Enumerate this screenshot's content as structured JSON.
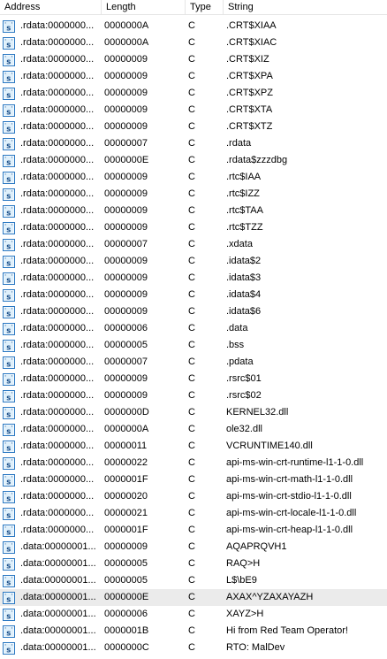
{
  "columns": {
    "address": "Address",
    "length": "Length",
    "type": "Type",
    "string": "String"
  },
  "icon": "string-literal-icon",
  "selected_row": 34,
  "rows": [
    {
      "address": ".rdata:0000000...",
      "length": "0000000A",
      "type": "C",
      "string": ".CRT$XIAA"
    },
    {
      "address": ".rdata:0000000...",
      "length": "0000000A",
      "type": "C",
      "string": ".CRT$XIAC"
    },
    {
      "address": ".rdata:0000000...",
      "length": "00000009",
      "type": "C",
      "string": ".CRT$XIZ"
    },
    {
      "address": ".rdata:0000000...",
      "length": "00000009",
      "type": "C",
      "string": ".CRT$XPA"
    },
    {
      "address": ".rdata:0000000...",
      "length": "00000009",
      "type": "C",
      "string": ".CRT$XPZ"
    },
    {
      "address": ".rdata:0000000...",
      "length": "00000009",
      "type": "C",
      "string": ".CRT$XTA"
    },
    {
      "address": ".rdata:0000000...",
      "length": "00000009",
      "type": "C",
      "string": ".CRT$XTZ"
    },
    {
      "address": ".rdata:0000000...",
      "length": "00000007",
      "type": "C",
      "string": ".rdata"
    },
    {
      "address": ".rdata:0000000...",
      "length": "0000000E",
      "type": "C",
      "string": ".rdata$zzzdbg"
    },
    {
      "address": ".rdata:0000000...",
      "length": "00000009",
      "type": "C",
      "string": ".rtc$IAA"
    },
    {
      "address": ".rdata:0000000...",
      "length": "00000009",
      "type": "C",
      "string": ".rtc$IZZ"
    },
    {
      "address": ".rdata:0000000...",
      "length": "00000009",
      "type": "C",
      "string": ".rtc$TAA"
    },
    {
      "address": ".rdata:0000000...",
      "length": "00000009",
      "type": "C",
      "string": ".rtc$TZZ"
    },
    {
      "address": ".rdata:0000000...",
      "length": "00000007",
      "type": "C",
      "string": ".xdata"
    },
    {
      "address": ".rdata:0000000...",
      "length": "00000009",
      "type": "C",
      "string": ".idata$2"
    },
    {
      "address": ".rdata:0000000...",
      "length": "00000009",
      "type": "C",
      "string": ".idata$3"
    },
    {
      "address": ".rdata:0000000...",
      "length": "00000009",
      "type": "C",
      "string": ".idata$4"
    },
    {
      "address": ".rdata:0000000...",
      "length": "00000009",
      "type": "C",
      "string": ".idata$6"
    },
    {
      "address": ".rdata:0000000...",
      "length": "00000006",
      "type": "C",
      "string": ".data"
    },
    {
      "address": ".rdata:0000000...",
      "length": "00000005",
      "type": "C",
      "string": ".bss"
    },
    {
      "address": ".rdata:0000000...",
      "length": "00000007",
      "type": "C",
      "string": ".pdata"
    },
    {
      "address": ".rdata:0000000...",
      "length": "00000009",
      "type": "C",
      "string": ".rsrc$01"
    },
    {
      "address": ".rdata:0000000...",
      "length": "00000009",
      "type": "C",
      "string": ".rsrc$02"
    },
    {
      "address": ".rdata:0000000...",
      "length": "0000000D",
      "type": "C",
      "string": "KERNEL32.dll"
    },
    {
      "address": ".rdata:0000000...",
      "length": "0000000A",
      "type": "C",
      "string": "ole32.dll"
    },
    {
      "address": ".rdata:0000000...",
      "length": "00000011",
      "type": "C",
      "string": "VCRUNTIME140.dll"
    },
    {
      "address": ".rdata:0000000...",
      "length": "00000022",
      "type": "C",
      "string": "api-ms-win-crt-runtime-l1-1-0.dll"
    },
    {
      "address": ".rdata:0000000...",
      "length": "0000001F",
      "type": "C",
      "string": "api-ms-win-crt-math-l1-1-0.dll"
    },
    {
      "address": ".rdata:0000000...",
      "length": "00000020",
      "type": "C",
      "string": "api-ms-win-crt-stdio-l1-1-0.dll"
    },
    {
      "address": ".rdata:0000000...",
      "length": "00000021",
      "type": "C",
      "string": "api-ms-win-crt-locale-l1-1-0.dll"
    },
    {
      "address": ".rdata:0000000...",
      "length": "0000001F",
      "type": "C",
      "string": "api-ms-win-crt-heap-l1-1-0.dll"
    },
    {
      "address": ".data:00000001...",
      "length": "00000009",
      "type": "C",
      "string": "AQAPRQVH1"
    },
    {
      "address": ".data:00000001...",
      "length": "00000005",
      "type": "C",
      "string": "RAQ>H"
    },
    {
      "address": ".data:00000001...",
      "length": "00000005",
      "type": "C",
      "string": "L$\\bE9"
    },
    {
      "address": ".data:00000001...",
      "length": "0000000E",
      "type": "C",
      "string": "AXAX^YZAXAYAZH"
    },
    {
      "address": ".data:00000001...",
      "length": "00000006",
      "type": "C",
      "string": "XAYZ>H"
    },
    {
      "address": ".data:00000001...",
      "length": "0000001B",
      "type": "C",
      "string": "Hi from Red Team Operator!"
    },
    {
      "address": ".data:00000001...",
      "length": "0000000C",
      "type": "C",
      "string": "RTO: MalDev"
    }
  ]
}
